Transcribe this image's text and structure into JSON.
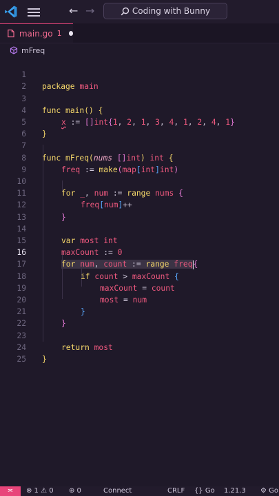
{
  "titlebar": {
    "search_text": "Coding with Bunny",
    "back_arrow": "←",
    "forward_arrow": "→",
    "icons": [
      "vscode-logo-icon",
      "menu-icon",
      "back-arrow-icon",
      "forward-arrow-icon",
      "search-icon"
    ]
  },
  "tab": {
    "filename": "main.go",
    "problem_count": "1",
    "dirty_indicator": "●"
  },
  "breadcrumb": {
    "symbol": "mFreq"
  },
  "editor": {
    "current_line": "16",
    "lines": [
      {
        "n": "1"
      },
      {
        "n": "2"
      },
      {
        "n": "3"
      },
      {
        "n": "4"
      },
      {
        "n": "5"
      },
      {
        "n": "6"
      },
      {
        "n": "7"
      },
      {
        "n": "8"
      },
      {
        "n": "9"
      },
      {
        "n": "10"
      },
      {
        "n": "11"
      },
      {
        "n": "12"
      },
      {
        "n": "13"
      },
      {
        "n": "14"
      },
      {
        "n": "15"
      },
      {
        "n": "16"
      },
      {
        "n": "17"
      },
      {
        "n": "18"
      },
      {
        "n": "19"
      },
      {
        "n": "20"
      },
      {
        "n": "21"
      },
      {
        "n": "22"
      },
      {
        "n": "23"
      },
      {
        "n": "24"
      },
      {
        "n": "25"
      }
    ],
    "tokens": {
      "package": "package",
      "main_pkg": "main",
      "func": "func",
      "main_fn": "main",
      "parens_open_brace": "() {",
      "x": "x",
      "assign": " := ",
      "slice_open": "[]",
      "int": "int",
      "lit_open": "{",
      "n1": "1",
      "n2": "2",
      "n3": "3",
      "n4": "4",
      "comma": ", ",
      "lit_close": "}",
      "brace_close": "}",
      "mfreq_fn": "mFreq",
      "paren_open": "(",
      "nums": "nums",
      "space_slice": " []",
      "paren_close": ")",
      "ret_int": " int ",
      "brace_open": "{",
      "freq": "freq",
      "make": "make",
      "map": "map",
      "bracket_open": "[",
      "bracket_close": "]",
      "for": "for",
      "underscore": "_",
      "num": "num",
      "range": "range",
      "incr": "++",
      "var": "var",
      "most": "most",
      "maxCount": "maxCount",
      "zero": "0",
      "count": "count",
      "if": "if",
      "gt": " > ",
      "eq": " = ",
      "return": "return"
    }
  },
  "statusbar": {
    "remote_icon": "remote-icon",
    "remote_glyph": "≍",
    "errors": "⊗ 1 ⚠ 0",
    "ports": "⊕ 0",
    "connect": "Connect",
    "eol": "CRLF",
    "language": "{} Go",
    "go_version": "1.21.3",
    "gear": "⚙ Go"
  },
  "colors": {
    "background": "#1f1929",
    "accent": "#e8457a",
    "keyword": "#f5d76a",
    "identifier": "#f0597f"
  }
}
